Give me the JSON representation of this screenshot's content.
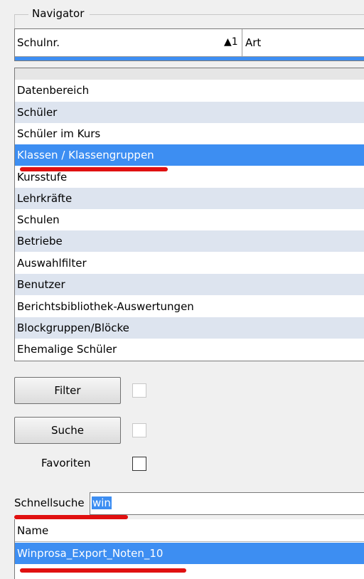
{
  "navigator": {
    "title": "Navigator"
  },
  "top_grid": {
    "columns": [
      "Schulnr.",
      "Art"
    ],
    "sort_indicator": "▲1"
  },
  "data_area": {
    "header": "Datenbereich",
    "items": [
      {
        "label": "Schüler"
      },
      {
        "label": "Schüler im Kurs"
      },
      {
        "label": "Klassen / Klassengruppen",
        "selected": true
      },
      {
        "label": "Kursstufe"
      },
      {
        "label": "Lehrkräfte"
      },
      {
        "label": "Schulen"
      },
      {
        "label": "Betriebe"
      },
      {
        "label": "Auswahlfilter"
      },
      {
        "label": "Benutzer"
      },
      {
        "label": "Berichtsbibliothek-Auswertungen"
      },
      {
        "label": "Blockgruppen/Blöcke"
      },
      {
        "label": "Ehemalige Schüler"
      }
    ]
  },
  "controls": {
    "filter_label": "Filter",
    "search_label": "Suche",
    "favorites_label": "Favoriten"
  },
  "quick_search": {
    "label": "Schnellsuche",
    "value": "win"
  },
  "results": {
    "header": "Name",
    "rows": [
      "Winprosa_Export_Noten_10"
    ]
  },
  "colors": {
    "selection": "#3d8ef2",
    "annotation": "#e01010",
    "row_alt": "#dde4ef"
  }
}
